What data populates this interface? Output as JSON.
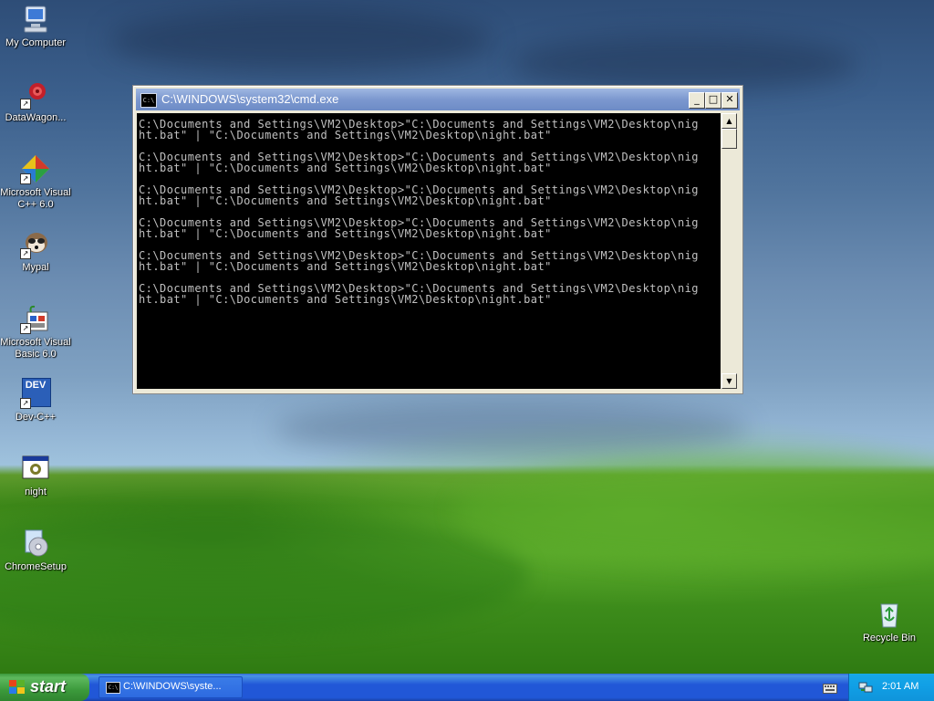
{
  "desktop": {
    "icons": [
      {
        "label": "My Computer",
        "icon": "my-computer-icon"
      },
      {
        "label": "DataWagon...",
        "icon": "datawagon-icon"
      },
      {
        "label": "Microsoft Visual C++ 6.0",
        "icon": "visual-cpp-icon"
      },
      {
        "label": "Mypal",
        "icon": "mypal-icon"
      },
      {
        "label": "Microsoft Visual Basic 6.0",
        "icon": "visual-basic-icon"
      },
      {
        "label": "Dev-C++",
        "icon": "dev-cpp-icon"
      },
      {
        "label": "night",
        "icon": "batch-file-icon"
      },
      {
        "label": "ChromeSetup",
        "icon": "installer-icon"
      },
      {
        "label": "Recycle Bin",
        "icon": "recycle-bin-icon"
      }
    ],
    "dev_icon_text": "DEV"
  },
  "cmd_window": {
    "title": "C:\\WINDOWS\\system32\\cmd.exe",
    "title_icon_text": "C:\\",
    "controls": {
      "minimize": "_",
      "maximize": "□",
      "close": "✕"
    },
    "output": "C:\\Documents and Settings\\VM2\\Desktop>\"C:\\Documents and Settings\\VM2\\Desktop\\nig\nht.bat\" | \"C:\\Documents and Settings\\VM2\\Desktop\\night.bat\"\n\nC:\\Documents and Settings\\VM2\\Desktop>\"C:\\Documents and Settings\\VM2\\Desktop\\nig\nht.bat\" | \"C:\\Documents and Settings\\VM2\\Desktop\\night.bat\"\n\nC:\\Documents and Settings\\VM2\\Desktop>\"C:\\Documents and Settings\\VM2\\Desktop\\nig\nht.bat\" | \"C:\\Documents and Settings\\VM2\\Desktop\\night.bat\"\n\nC:\\Documents and Settings\\VM2\\Desktop>\"C:\\Documents and Settings\\VM2\\Desktop\\nig\nht.bat\" | \"C:\\Documents and Settings\\VM2\\Desktop\\night.bat\"\n\nC:\\Documents and Settings\\VM2\\Desktop>\"C:\\Documents and Settings\\VM2\\Desktop\\nig\nht.bat\" | \"C:\\Documents and Settings\\VM2\\Desktop\\night.bat\"\n\nC:\\Documents and Settings\\VM2\\Desktop>\"C:\\Documents and Settings\\VM2\\Desktop\\nig\nht.bat\" | \"C:\\Documents and Settings\\VM2\\Desktop\\night.bat\""
  },
  "taskbar": {
    "start_label": "start",
    "task_button_label": "C:\\WINDOWS\\syste...",
    "task_icon_text": "C:\\",
    "clock": "2:01 AM"
  },
  "colors": {
    "console_bg": "#000000",
    "console_fg": "#c0c0c0",
    "taskbar_blue": "#2157d7",
    "start_green": "#3c9a3c",
    "tray_blue": "#11a0e6"
  }
}
